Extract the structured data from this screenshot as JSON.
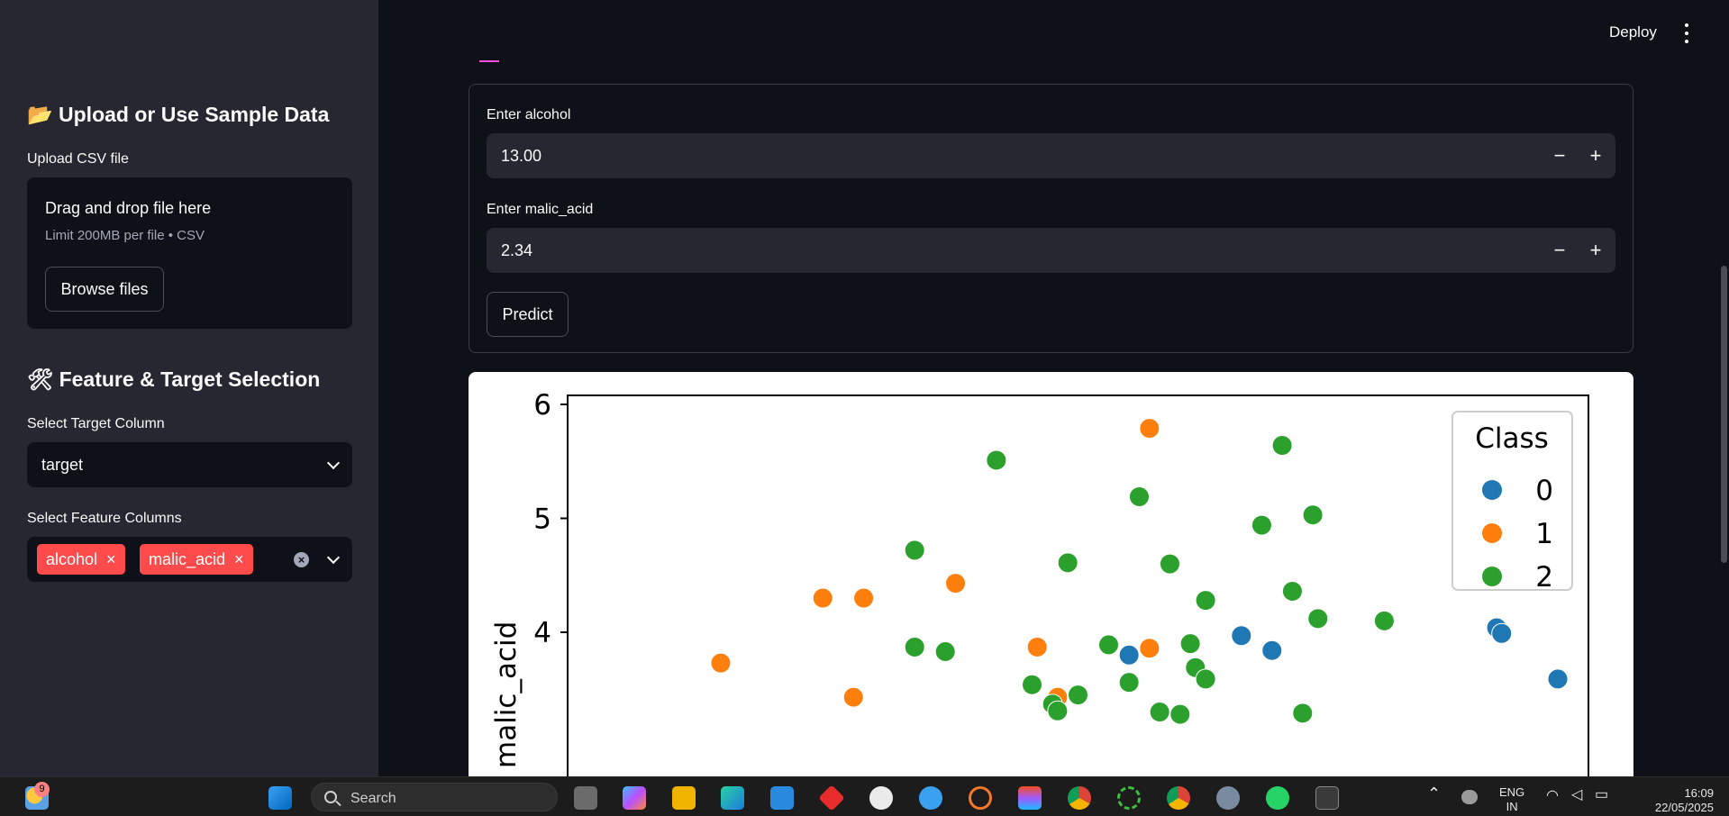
{
  "sidebar": {
    "upload_heading": "📂 Upload or Use Sample Data",
    "upload_label": "Upload CSV file",
    "dropzone_title": "Drag and drop file here",
    "dropzone_limit": "Limit 200MB per file • CSV",
    "browse_button": "Browse files",
    "feature_heading": "🛠 Feature & Target Selection",
    "target_label": "Select Target Column",
    "target_value": "target",
    "features_label": "Select Feature Columns",
    "feature_tags": [
      "alcohol",
      "malic_acid"
    ]
  },
  "header": {
    "deploy": "Deploy"
  },
  "form": {
    "alcohol_label": "Enter alcohol",
    "alcohol_value": "13.00",
    "malic_label": "Enter malic_acid",
    "malic_value": "2.34",
    "minus": "−",
    "plus": "+",
    "predict_button": "Predict"
  },
  "chart_data": {
    "type": "scatter",
    "ylabel": "malic_acid",
    "y_ticks": [
      "6",
      "5",
      "4"
    ],
    "y_visible_range": [
      3.2,
      6.07
    ],
    "legend_title": "Class",
    "legend_placement": "top-right",
    "series": [
      {
        "name": "0",
        "color": "#1f77b4",
        "points": [
          [
            0.55,
            3.8
          ],
          [
            0.66,
            3.97
          ],
          [
            0.69,
            3.84
          ],
          [
            0.91,
            4.04
          ],
          [
            0.915,
            3.99
          ],
          [
            0.97,
            3.59
          ]
        ]
      },
      {
        "name": "1",
        "color": "#ff7f0e",
        "points": [
          [
            0.15,
            3.73
          ],
          [
            0.25,
            4.3
          ],
          [
            0.29,
            4.3
          ],
          [
            0.28,
            3.43
          ],
          [
            0.38,
            4.43
          ],
          [
            0.46,
            3.87
          ],
          [
            0.48,
            3.43
          ],
          [
            0.57,
            5.79
          ],
          [
            0.57,
            3.86
          ]
        ]
      },
      {
        "name": "2",
        "color": "#2ca02c",
        "points": [
          [
            0.34,
            4.72
          ],
          [
            0.34,
            3.87
          ],
          [
            0.37,
            3.83
          ],
          [
            0.42,
            5.51
          ],
          [
            0.455,
            3.54
          ],
          [
            0.475,
            3.37
          ],
          [
            0.48,
            3.31
          ],
          [
            0.49,
            4.61
          ],
          [
            0.5,
            3.45
          ],
          [
            0.53,
            3.89
          ],
          [
            0.55,
            3.56
          ],
          [
            0.56,
            5.19
          ],
          [
            0.625,
            4.28
          ],
          [
            0.58,
            3.3
          ],
          [
            0.59,
            4.6
          ],
          [
            0.6,
            3.28
          ],
          [
            0.61,
            3.9
          ],
          [
            0.615,
            3.69
          ],
          [
            0.625,
            3.59
          ],
          [
            0.68,
            4.94
          ],
          [
            0.7,
            5.64
          ],
          [
            0.71,
            4.36
          ],
          [
            0.73,
            5.03
          ],
          [
            0.735,
            4.12
          ],
          [
            0.72,
            3.29
          ],
          [
            0.8,
            4.1
          ]
        ]
      }
    ]
  },
  "taskbar": {
    "weather_badge": "9",
    "search": "Search",
    "lang_line1": "ENG",
    "lang_line2": "IN",
    "time": "16:09",
    "date": "22/05/2025"
  }
}
